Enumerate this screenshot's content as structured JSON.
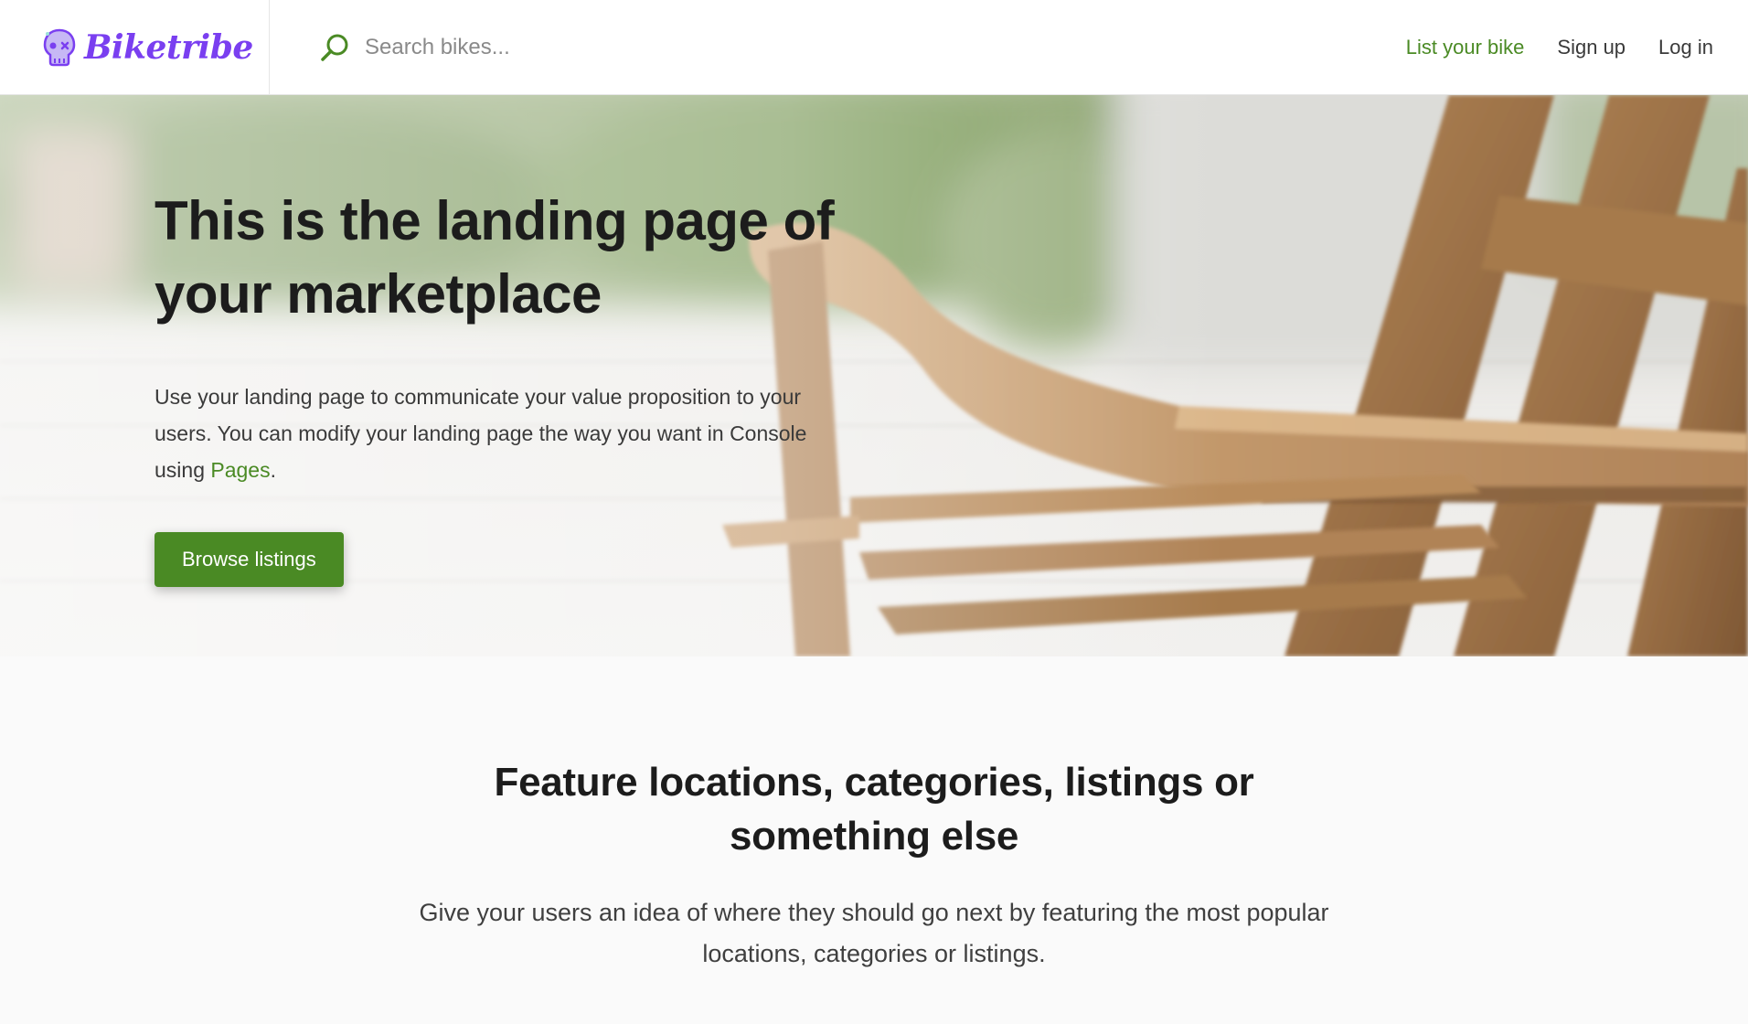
{
  "brand": {
    "name": "Biketribe",
    "logo_icon": "skull-icon",
    "color": "#7a3ff0"
  },
  "search": {
    "icon": "search-icon",
    "placeholder": "Search bikes..."
  },
  "nav": {
    "list_your_bike": "List your bike",
    "sign_up": "Sign up",
    "log_in": "Log in"
  },
  "hero": {
    "title": "This is the landing page of your marketplace",
    "text_before_link": "Use your landing page to communicate your value proposition to your users. You can modify your landing page the way you want in Console using ",
    "link_text": "Pages",
    "text_after_link": ".",
    "cta_label": "Browse listings",
    "background": "wooden deck chair photo"
  },
  "feature": {
    "title": "Feature locations, categories, listings or something else",
    "text": "Give your users an idea of where they should go next by featuring the most popular locations, categories or listings."
  },
  "colors": {
    "accent_green": "#4a8a24",
    "brand_purple": "#7a3ff0",
    "text_dark": "#1c1c1c"
  }
}
